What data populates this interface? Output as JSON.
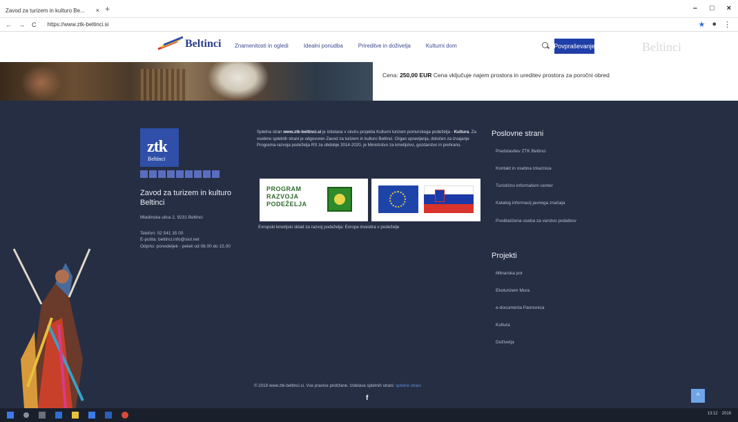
{
  "browser": {
    "tab_title": "Zavod za turizem in kulturo Be...",
    "tab_close": "×",
    "new_tab": "+",
    "url": "https://www.ztk-beltinci.si",
    "nav_back": "←",
    "nav_forward": "→",
    "nav_reload": "C",
    "lock": "🔒",
    "window_controls": [
      "–",
      "□",
      "×"
    ],
    "star": "★",
    "menu": "⋮",
    "profile": "●"
  },
  "site": {
    "logo_text": "Beltinci",
    "nav": [
      "Znamenitosti in ogledi",
      "Idealni ponudba",
      "Prireditve in doživetja",
      "Kulturni dom"
    ],
    "inquiry_button": "Povpraševanje",
    "ghost_text": "Beltinci"
  },
  "content": {
    "price_label": "Cena:",
    "price_value": "250,00 EUR",
    "price_desc": "Cena vključuje najem prostora in ureditev prostora za poročni obred"
  },
  "footer": {
    "ztk_logo": "ztk",
    "ztk_sub": "Beltinci",
    "org_name": "Zavod za turizem in kulturo Beltinci",
    "address": "Mladinska ulica 2, 9231 Beltinci",
    "phone": "Telefon: 02 541 35 00",
    "email": "E-pošta: beltinci.info@siol.net",
    "hours": "Odprto: ponedeljek - petek od 08.00 do 15.00",
    "about_lead": "Spletna stran ",
    "about_domain": "www.ztk-beltinci.si",
    "about_mid": " je izdelana v okviru projekta Kulturni turizem pomurskega podeželja - ",
    "about_bold": "Kultura",
    "about_rest": ". Za vsebino spletnih strani je odgovoren Zavod za turizem in kulturo Beltinci. Organ upravljanja, določen za izvajanje Programa razvoja podeželja RS za obdobje 2014-2020, je Ministrstvo za kmetijstvo, gozdarstvo in prehrano.",
    "badge_program": [
      "PROGRAM",
      "RAZVOJA",
      "PODEŽELJA"
    ],
    "badge_caption": "Evropski kmetijski sklad za razvoj podeželja: Evropa investira v podeželje",
    "business_title": "Poslovne strani",
    "business_links": [
      "Predstavitev ZTK Beltinci",
      "Kontakt in osebna izkaznica",
      "Turistično informativni center",
      "Katalog informacij javnega značaja",
      "Pooblaščena oseba za varstvo podatkov"
    ],
    "projects_title": "Projekti",
    "project_links": [
      "Mlinarska pot",
      "Ekoturizem Mura",
      "e-documenta Pannonica",
      "Kultura",
      "Doživetja"
    ],
    "copyright_text": "© 2018 www.ztk-beltinci.si. Vse pravice pridržane. Izdelava spletnih strani: ",
    "copyright_link": "spletne strani",
    "facebook": "f",
    "to_top": "^"
  },
  "taskbar": {
    "time": "13:12",
    "date": "2018"
  },
  "colors": {
    "footer_bg": "#262e44",
    "accent": "#1f3fa8",
    "link": "#5d8fd8"
  }
}
